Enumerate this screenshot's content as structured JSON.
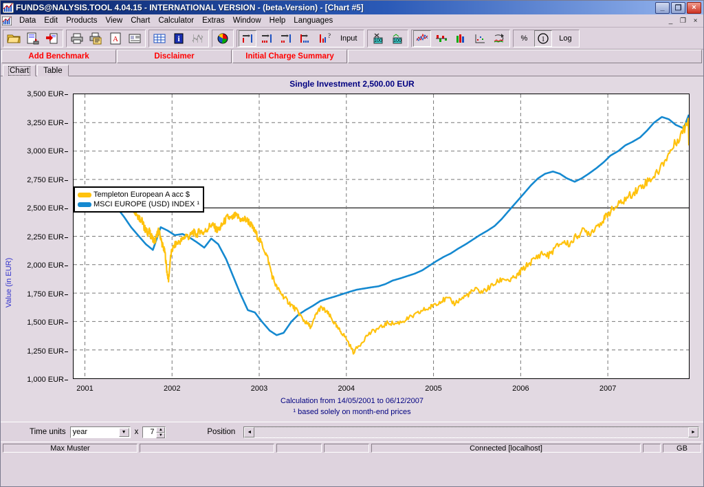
{
  "window": {
    "title": "FUNDS@NALYSIS.TOOL 4.04.15 - INTERNATIONAL VERSION - (beta-Version) - [Chart #5]",
    "minimize": "_",
    "maximize": "❐",
    "close": "×"
  },
  "mdi": {
    "minimize": "_",
    "restore": "❐",
    "close": "×"
  },
  "menu": {
    "items": [
      "Data",
      "Edit",
      "Products",
      "View",
      "Chart",
      "Calculator",
      "Extras",
      "Window",
      "Help",
      "Languages"
    ]
  },
  "toolbar": {
    "groups": [
      {
        "buttons": [
          {
            "name": "open-folder-icon",
            "label": ""
          },
          {
            "name": "save-document-icon",
            "label": ""
          },
          {
            "name": "export-document-icon",
            "label": ""
          }
        ]
      },
      {
        "buttons": [
          {
            "name": "print-icon",
            "label": ""
          },
          {
            "name": "print-preview-icon",
            "label": ""
          },
          {
            "name": "pdf-export-icon",
            "label": ""
          },
          {
            "name": "report-icon",
            "label": ""
          }
        ]
      },
      {
        "buttons": [
          {
            "name": "table-grid-icon",
            "label": ""
          },
          {
            "name": "info-icon",
            "label": ""
          },
          {
            "name": "statistics-icon",
            "label": ""
          }
        ]
      },
      {
        "buttons": [
          {
            "name": "pie-chart-icon",
            "label": ""
          }
        ]
      },
      {
        "buttons": [
          {
            "name": "single-investment-icon",
            "label": "",
            "pressed": true
          },
          {
            "name": "savings-plan-icon",
            "label": ""
          },
          {
            "name": "withdrawal-plan-icon",
            "label": ""
          },
          {
            "name": "combined-plan-icon",
            "label": ""
          },
          {
            "name": "what-if-icon",
            "label": ""
          },
          {
            "name": "input-button",
            "label": "Input"
          }
        ]
      },
      {
        "buttons": [
          {
            "name": "calculator-scissors-icon",
            "label": ""
          },
          {
            "name": "calculator-icon",
            "label": ""
          }
        ]
      },
      {
        "buttons": [
          {
            "name": "line-chart-icon",
            "label": "",
            "pressed": true
          },
          {
            "name": "bar-chart-negative-icon",
            "label": ""
          },
          {
            "name": "column-chart-icon",
            "label": ""
          },
          {
            "name": "scatter-chart-icon",
            "label": ""
          },
          {
            "name": "rolling-chart-icon",
            "label": ""
          }
        ]
      },
      {
        "buttons": [
          {
            "name": "percent-button",
            "label": "%"
          },
          {
            "name": "currency-button",
            "label": ""
          },
          {
            "name": "log-scale-button",
            "label": "Log"
          }
        ]
      }
    ]
  },
  "redbar": {
    "buttons": [
      "Add Benchmark",
      "Disclaimer",
      "Initial Charge Summary"
    ]
  },
  "tabs": [
    {
      "label": "Chart",
      "active": true
    },
    {
      "label": "Table",
      "active": false
    }
  ],
  "controls": {
    "time_units_label": "Time units",
    "time_units_value": "year",
    "multiplier_symbol": "x",
    "multiplier_value": "7",
    "position_label": "Position",
    "scroll_left": "◄",
    "scroll_right": "►",
    "spin_up": "▲",
    "spin_down": "▼",
    "combo_arrow": "▼"
  },
  "statusbar": {
    "user": "Max Muster",
    "field2": "",
    "field3": "",
    "field4": "",
    "connection": "Connected [localhost]",
    "field6": "",
    "locale": "GB"
  },
  "colors": {
    "fund_line": "#FFC20E",
    "benchmark_line": "#1589D0",
    "title_blue": "#000080",
    "axis_label_blue": "#3333CC",
    "red_button_text": "#FF0000",
    "window_bg": "#DED3DE",
    "plot_bg": "#FFFFFF"
  },
  "chart_data": {
    "type": "line",
    "title": "Single Investment 2,500.00 EUR",
    "xlabel": "",
    "ylabel": "Value (in EUR)",
    "ylim": [
      1000,
      3500
    ],
    "y_ticks": [
      1000,
      1250,
      1500,
      1750,
      2000,
      2250,
      2500,
      2750,
      3000,
      3250,
      3500
    ],
    "y_tick_labels": [
      "1,000 EUR",
      "1,250 EUR",
      "1,500 EUR",
      "1,750 EUR",
      "2,000 EUR",
      "2,250 EUR",
      "2,500 EUR",
      "2,750 EUR",
      "3,000 EUR",
      "3,250 EUR",
      "3,500 EUR"
    ],
    "x_tick_labels": [
      "2001",
      "2002",
      "2003",
      "2004",
      "2005",
      "2006",
      "2007"
    ],
    "x_tick_values": [
      2001.0,
      2002.0,
      2003.0,
      2004.0,
      2005.0,
      2006.0,
      2007.0
    ],
    "xlim": [
      2000.87,
      2007.93
    ],
    "grid": true,
    "baseline": 2500,
    "legend_position": "top-left",
    "annotations": [
      "Calculation from 14/05/2001 to 06/12/2007",
      "¹ based solely on month-end prices"
    ],
    "series": [
      {
        "name": "Templeton European A acc $",
        "color": "#FFC20E",
        "x": [
          2001.37,
          2001.41,
          2001.44,
          2001.46,
          2001.48,
          2001.5,
          2001.52,
          2001.54,
          2001.56,
          2001.58,
          2001.6,
          2001.62,
          2001.64,
          2001.66,
          2001.68,
          2001.7,
          2001.72,
          2001.74,
          2001.76,
          2001.78,
          2001.8,
          2001.82,
          2001.84,
          2001.86,
          2001.88,
          2001.9,
          2001.92,
          2001.94,
          2001.96,
          2001.98,
          2002.0,
          2002.04,
          2002.08,
          2002.12,
          2002.16,
          2002.2,
          2002.24,
          2002.28,
          2002.32,
          2002.36,
          2002.4,
          2002.44,
          2002.48,
          2002.52,
          2002.56,
          2002.6,
          2002.64,
          2002.68,
          2002.72,
          2002.76,
          2002.8,
          2002.84,
          2002.88,
          2002.92,
          2002.96,
          2003.0,
          2003.05,
          2003.1,
          2003.15,
          2003.2,
          2003.25,
          2003.3,
          2003.35,
          2003.4,
          2003.45,
          2003.5,
          2003.55,
          2003.6,
          2003.65,
          2003.7,
          2003.75,
          2003.8,
          2003.85,
          2003.9,
          2003.95,
          2004.0,
          2004.08,
          2004.16,
          2004.24,
          2004.32,
          2004.4,
          2004.48,
          2004.56,
          2004.64,
          2004.72,
          2004.8,
          2004.88,
          2004.96,
          2005.0,
          2005.08,
          2005.16,
          2005.24,
          2005.32,
          2005.4,
          2005.48,
          2005.56,
          2005.64,
          2005.72,
          2005.8,
          2005.88,
          2005.96,
          2006.0,
          2006.08,
          2006.16,
          2006.24,
          2006.32,
          2006.4,
          2006.48,
          2006.56,
          2006.64,
          2006.72,
          2006.8,
          2006.88,
          2006.96,
          2007.0,
          2007.08,
          2007.16,
          2007.24,
          2007.32,
          2007.4,
          2007.48,
          2007.56,
          2007.64,
          2007.72,
          2007.8,
          2007.88,
          2007.93
        ],
        "y": [
          2500,
          2560,
          2520,
          2575,
          2530,
          2555,
          2500,
          2520,
          2480,
          2470,
          2440,
          2420,
          2400,
          2380,
          2330,
          2300,
          2280,
          2290,
          2250,
          2230,
          2200,
          2240,
          2300,
          2270,
          2200,
          2150,
          2100,
          1950,
          1860,
          2050,
          2130,
          2180,
          2200,
          2220,
          2260,
          2240,
          2290,
          2260,
          2300,
          2280,
          2310,
          2350,
          2340,
          2300,
          2330,
          2380,
          2420,
          2400,
          2430,
          2420,
          2390,
          2400,
          2380,
          2330,
          2280,
          2220,
          2150,
          2050,
          1900,
          1800,
          1750,
          1700,
          1660,
          1620,
          1580,
          1520,
          1480,
          1450,
          1560,
          1620,
          1600,
          1560,
          1500,
          1440,
          1400,
          1350,
          1230,
          1300,
          1380,
          1420,
          1450,
          1490,
          1480,
          1500,
          1530,
          1560,
          1600,
          1620,
          1650,
          1680,
          1700,
          1660,
          1700,
          1740,
          1780,
          1760,
          1800,
          1840,
          1880,
          1860,
          1900,
          1940,
          2000,
          2050,
          2100,
          2080,
          2150,
          2200,
          2180,
          2250,
          2300,
          2280,
          2350,
          2400,
          2450,
          2500,
          2550,
          2600,
          2650,
          2700,
          2750,
          2800,
          2900,
          3000,
          3100,
          3200,
          3300,
          3050
        ]
      },
      {
        "name": "MSCI EUROPE (USD) INDEX ¹",
        "color": "#1589D0",
        "x": [
          2001.37,
          2001.45,
          2001.53,
          2001.62,
          2001.7,
          2001.78,
          2001.87,
          2001.95,
          2002.03,
          2002.12,
          2002.2,
          2002.28,
          2002.37,
          2002.45,
          2002.53,
          2002.62,
          2002.7,
          2002.78,
          2002.87,
          2002.95,
          2003.03,
          2003.12,
          2003.2,
          2003.28,
          2003.37,
          2003.45,
          2003.53,
          2003.62,
          2003.7,
          2003.78,
          2003.87,
          2003.95,
          2004.03,
          2004.12,
          2004.2,
          2004.28,
          2004.37,
          2004.45,
          2004.53,
          2004.62,
          2004.7,
          2004.78,
          2004.87,
          2004.95,
          2005.03,
          2005.12,
          2005.2,
          2005.28,
          2005.37,
          2005.45,
          2005.53,
          2005.62,
          2005.7,
          2005.78,
          2005.87,
          2005.95,
          2006.03,
          2006.12,
          2006.2,
          2006.28,
          2006.37,
          2006.45,
          2006.53,
          2006.62,
          2006.7,
          2006.78,
          2006.87,
          2006.95,
          2007.03,
          2007.12,
          2007.2,
          2007.28,
          2007.37,
          2007.45,
          2007.53,
          2007.62,
          2007.7,
          2007.78,
          2007.87,
          2007.93
        ],
        "y": [
          2500,
          2420,
          2330,
          2250,
          2180,
          2130,
          2330,
          2300,
          2260,
          2270,
          2240,
          2200,
          2150,
          2230,
          2180,
          2050,
          1900,
          1750,
          1600,
          1580,
          1500,
          1420,
          1380,
          1400,
          1500,
          1560,
          1600,
          1640,
          1680,
          1700,
          1720,
          1740,
          1760,
          1780,
          1790,
          1800,
          1810,
          1830,
          1860,
          1880,
          1900,
          1920,
          1950,
          1990,
          2030,
          2070,
          2100,
          2140,
          2180,
          2220,
          2260,
          2300,
          2340,
          2400,
          2480,
          2550,
          2620,
          2700,
          2760,
          2800,
          2820,
          2800,
          2760,
          2730,
          2760,
          2800,
          2850,
          2900,
          2960,
          3000,
          3050,
          3080,
          3120,
          3180,
          3250,
          3300,
          3280,
          3230,
          3200,
          3320
        ]
      }
    ]
  }
}
